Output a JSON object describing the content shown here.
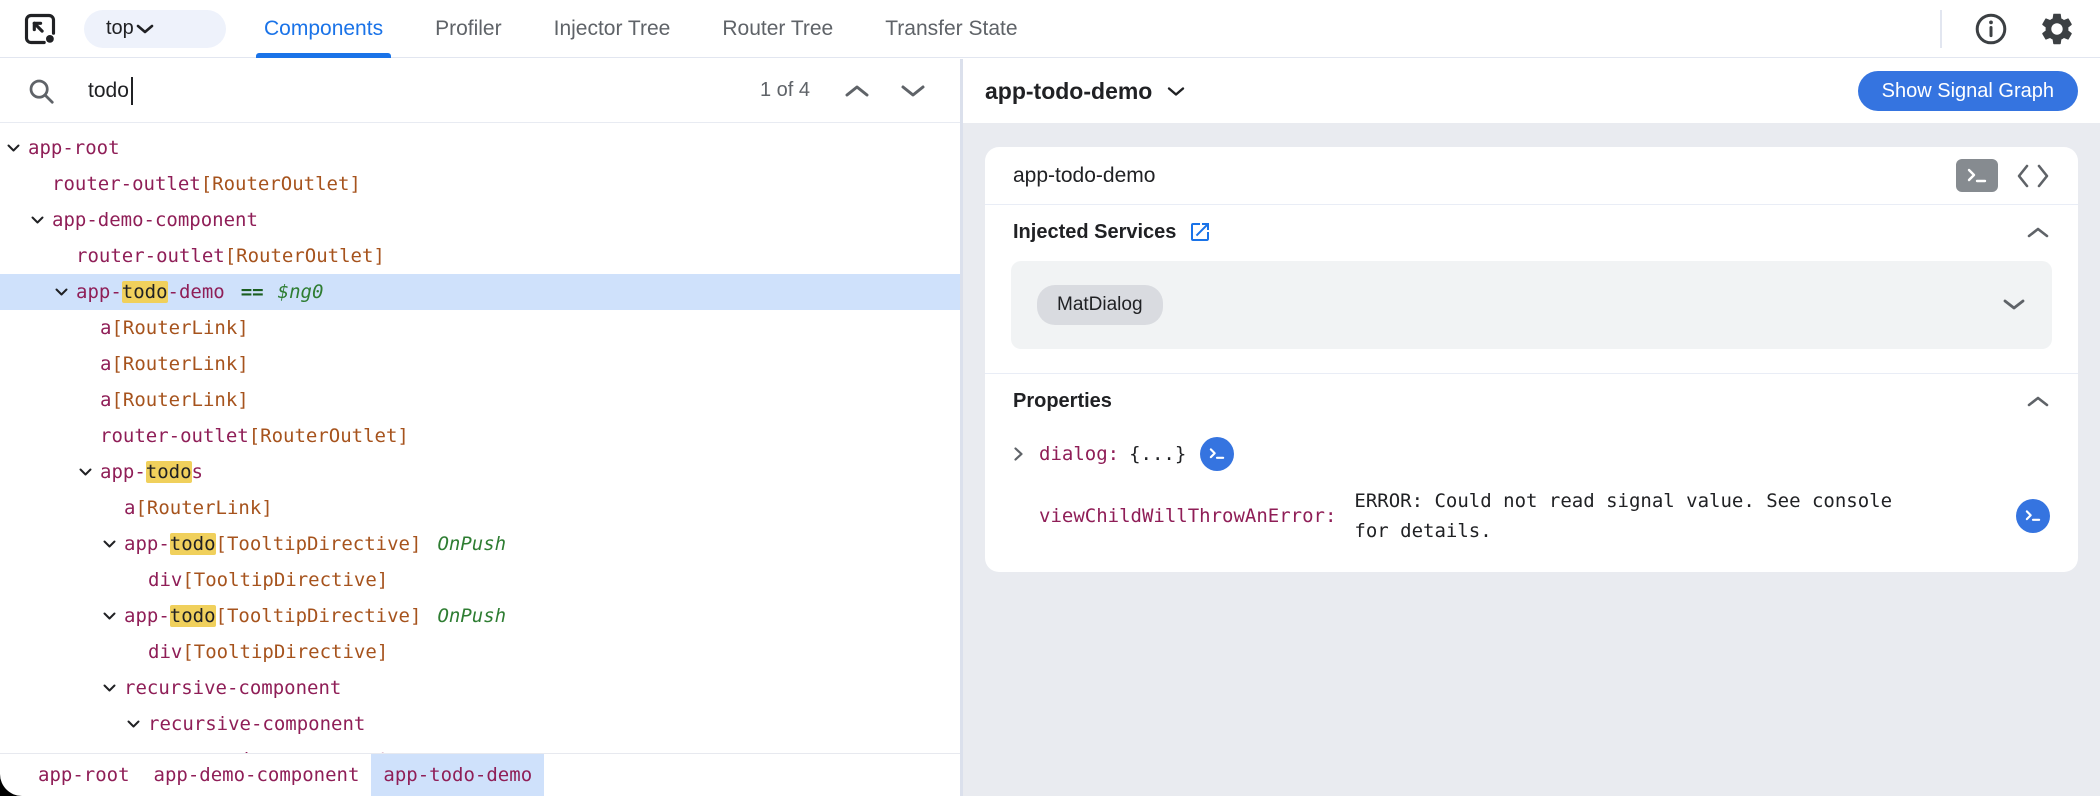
{
  "topbar": {
    "frame_selector": {
      "value": "top"
    },
    "tabs": [
      {
        "label": "Components",
        "active": true
      },
      {
        "label": "Profiler",
        "active": false
      },
      {
        "label": "Injector Tree",
        "active": false
      },
      {
        "label": "Router Tree",
        "active": false
      },
      {
        "label": "Transfer State",
        "active": false
      }
    ]
  },
  "search": {
    "value": "todo",
    "results": "1 of 4"
  },
  "tree": {
    "rows": [
      {
        "i": 0,
        "caret": true,
        "sel": false,
        "seg": [
          [
            "n",
            "app-root"
          ]
        ]
      },
      {
        "i": 1,
        "caret": false,
        "sel": false,
        "seg": [
          [
            "n",
            "router-outlet"
          ],
          [
            "b",
            "[RouterOutlet]"
          ]
        ]
      },
      {
        "i": 1,
        "caret": true,
        "sel": false,
        "seg": [
          [
            "n",
            "app-demo-component"
          ]
        ]
      },
      {
        "i": 2,
        "caret": false,
        "sel": false,
        "seg": [
          [
            "n",
            "router-outlet"
          ],
          [
            "b",
            "[RouterOutlet]"
          ]
        ]
      },
      {
        "i": 2,
        "caret": true,
        "sel": true,
        "seg": [
          [
            "n",
            "app-"
          ],
          [
            "h",
            "todo"
          ],
          [
            "n",
            "-demo"
          ],
          [
            "eq",
            "=="
          ],
          [
            "ref",
            "$ng0"
          ]
        ]
      },
      {
        "i": 3,
        "caret": false,
        "sel": false,
        "seg": [
          [
            "n",
            "a"
          ],
          [
            "b",
            "[RouterLink]"
          ]
        ]
      },
      {
        "i": 3,
        "caret": false,
        "sel": false,
        "seg": [
          [
            "n",
            "a"
          ],
          [
            "b",
            "[RouterLink]"
          ]
        ]
      },
      {
        "i": 3,
        "caret": false,
        "sel": false,
        "seg": [
          [
            "n",
            "a"
          ],
          [
            "b",
            "[RouterLink]"
          ]
        ]
      },
      {
        "i": 3,
        "caret": false,
        "sel": false,
        "seg": [
          [
            "n",
            "router-outlet"
          ],
          [
            "b",
            "[RouterOutlet]"
          ]
        ]
      },
      {
        "i": 3,
        "caret": true,
        "sel": false,
        "seg": [
          [
            "n",
            "app-"
          ],
          [
            "h",
            "todo"
          ],
          [
            "n",
            "s"
          ]
        ]
      },
      {
        "i": 4,
        "caret": false,
        "sel": false,
        "seg": [
          [
            "n",
            "a"
          ],
          [
            "b",
            "[RouterLink]"
          ]
        ]
      },
      {
        "i": 4,
        "caret": true,
        "sel": false,
        "seg": [
          [
            "n",
            "app-"
          ],
          [
            "h",
            "todo"
          ],
          [
            "b",
            "[TooltipDirective]"
          ],
          [
            "mod",
            "OnPush"
          ]
        ]
      },
      {
        "i": 5,
        "caret": false,
        "sel": false,
        "seg": [
          [
            "n",
            "div"
          ],
          [
            "b",
            "[TooltipDirective]"
          ]
        ]
      },
      {
        "i": 4,
        "caret": true,
        "sel": false,
        "seg": [
          [
            "n",
            "app-"
          ],
          [
            "h",
            "todo"
          ],
          [
            "b",
            "[TooltipDirective]"
          ],
          [
            "mod",
            "OnPush"
          ]
        ]
      },
      {
        "i": 5,
        "caret": false,
        "sel": false,
        "seg": [
          [
            "n",
            "div"
          ],
          [
            "b",
            "[TooltipDirective]"
          ]
        ]
      },
      {
        "i": 4,
        "caret": true,
        "sel": false,
        "seg": [
          [
            "n",
            "recursive-component"
          ]
        ]
      },
      {
        "i": 5,
        "caret": true,
        "sel": false,
        "seg": [
          [
            "n",
            "recursive-component"
          ]
        ]
      },
      {
        "i": 6,
        "caret": true,
        "sel": false,
        "seg": [
          [
            "n",
            "recursive-component"
          ]
        ]
      }
    ]
  },
  "breadcrumb": {
    "items": [
      {
        "label": "app-root",
        "selected": false
      },
      {
        "label": "app-demo-component",
        "selected": false
      },
      {
        "label": "app-todo-demo",
        "selected": true
      }
    ]
  },
  "details": {
    "title": "app-todo-demo",
    "signal_button": "Show Signal Graph",
    "card": {
      "title": "app-todo-demo",
      "injected_services_label": "Injected Services",
      "service_chips": [
        "MatDialog"
      ],
      "properties_label": "Properties",
      "properties": [
        {
          "key": "dialog",
          "value": "{...}",
          "expandable": true,
          "icon_far_right": false
        },
        {
          "key": "viewChildWillThrowAnError",
          "value": "ERROR: Could not read signal value. See console for details.",
          "expandable": false,
          "icon_far_right": true
        }
      ]
    }
  },
  "colors": {
    "accent": "#1a73e8",
    "button_blue": "#3574e0",
    "selection_blue": "#cfe1fb",
    "match_highlight": "#f0d05c",
    "component_name": "#8f1e57",
    "directive_attr": "#a6531d",
    "on_push_green": "#2e7d32",
    "text_primary": "#202124",
    "text_secondary": "#5f6368"
  }
}
